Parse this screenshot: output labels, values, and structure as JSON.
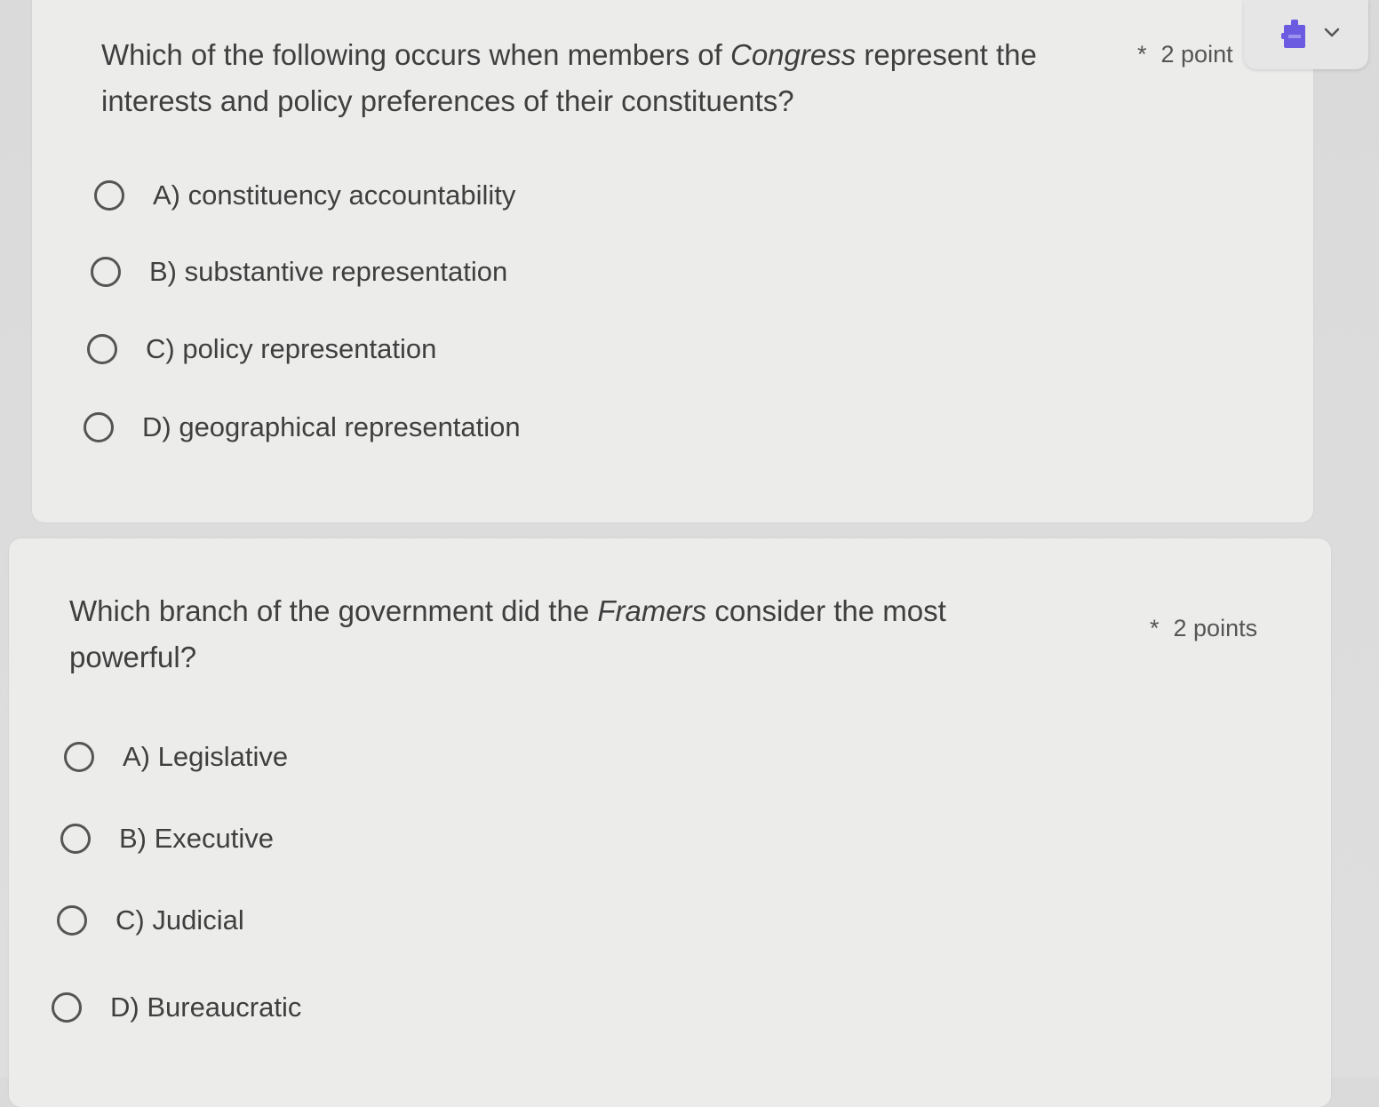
{
  "questions": [
    {
      "text_before": "Which of the following occurs when members of ",
      "text_emphasis": "Congress",
      "text_after": " represent the interests and policy preferences of their constituents?",
      "required_mark": "*",
      "points": "2 point",
      "options": [
        {
          "label": "A) constituency accountability"
        },
        {
          "label": "B) substantive representation"
        },
        {
          "label": "C) policy representation"
        },
        {
          "label": "D) geographical representation"
        }
      ]
    },
    {
      "text_before": "Which branch of the government did the ",
      "text_emphasis": "Framers",
      "text_after": " consider the most powerful?",
      "required_mark": "*",
      "points": "2 points",
      "options": [
        {
          "label": "A) Legislative"
        },
        {
          "label": "B) Executive"
        },
        {
          "label": "C) Judicial"
        },
        {
          "label": "D) Bureaucratic"
        }
      ]
    }
  ],
  "extension": {
    "icon": "puzzle-extension-icon",
    "chevron": "chevron-down-icon",
    "accent_color": "#6a5be0"
  }
}
